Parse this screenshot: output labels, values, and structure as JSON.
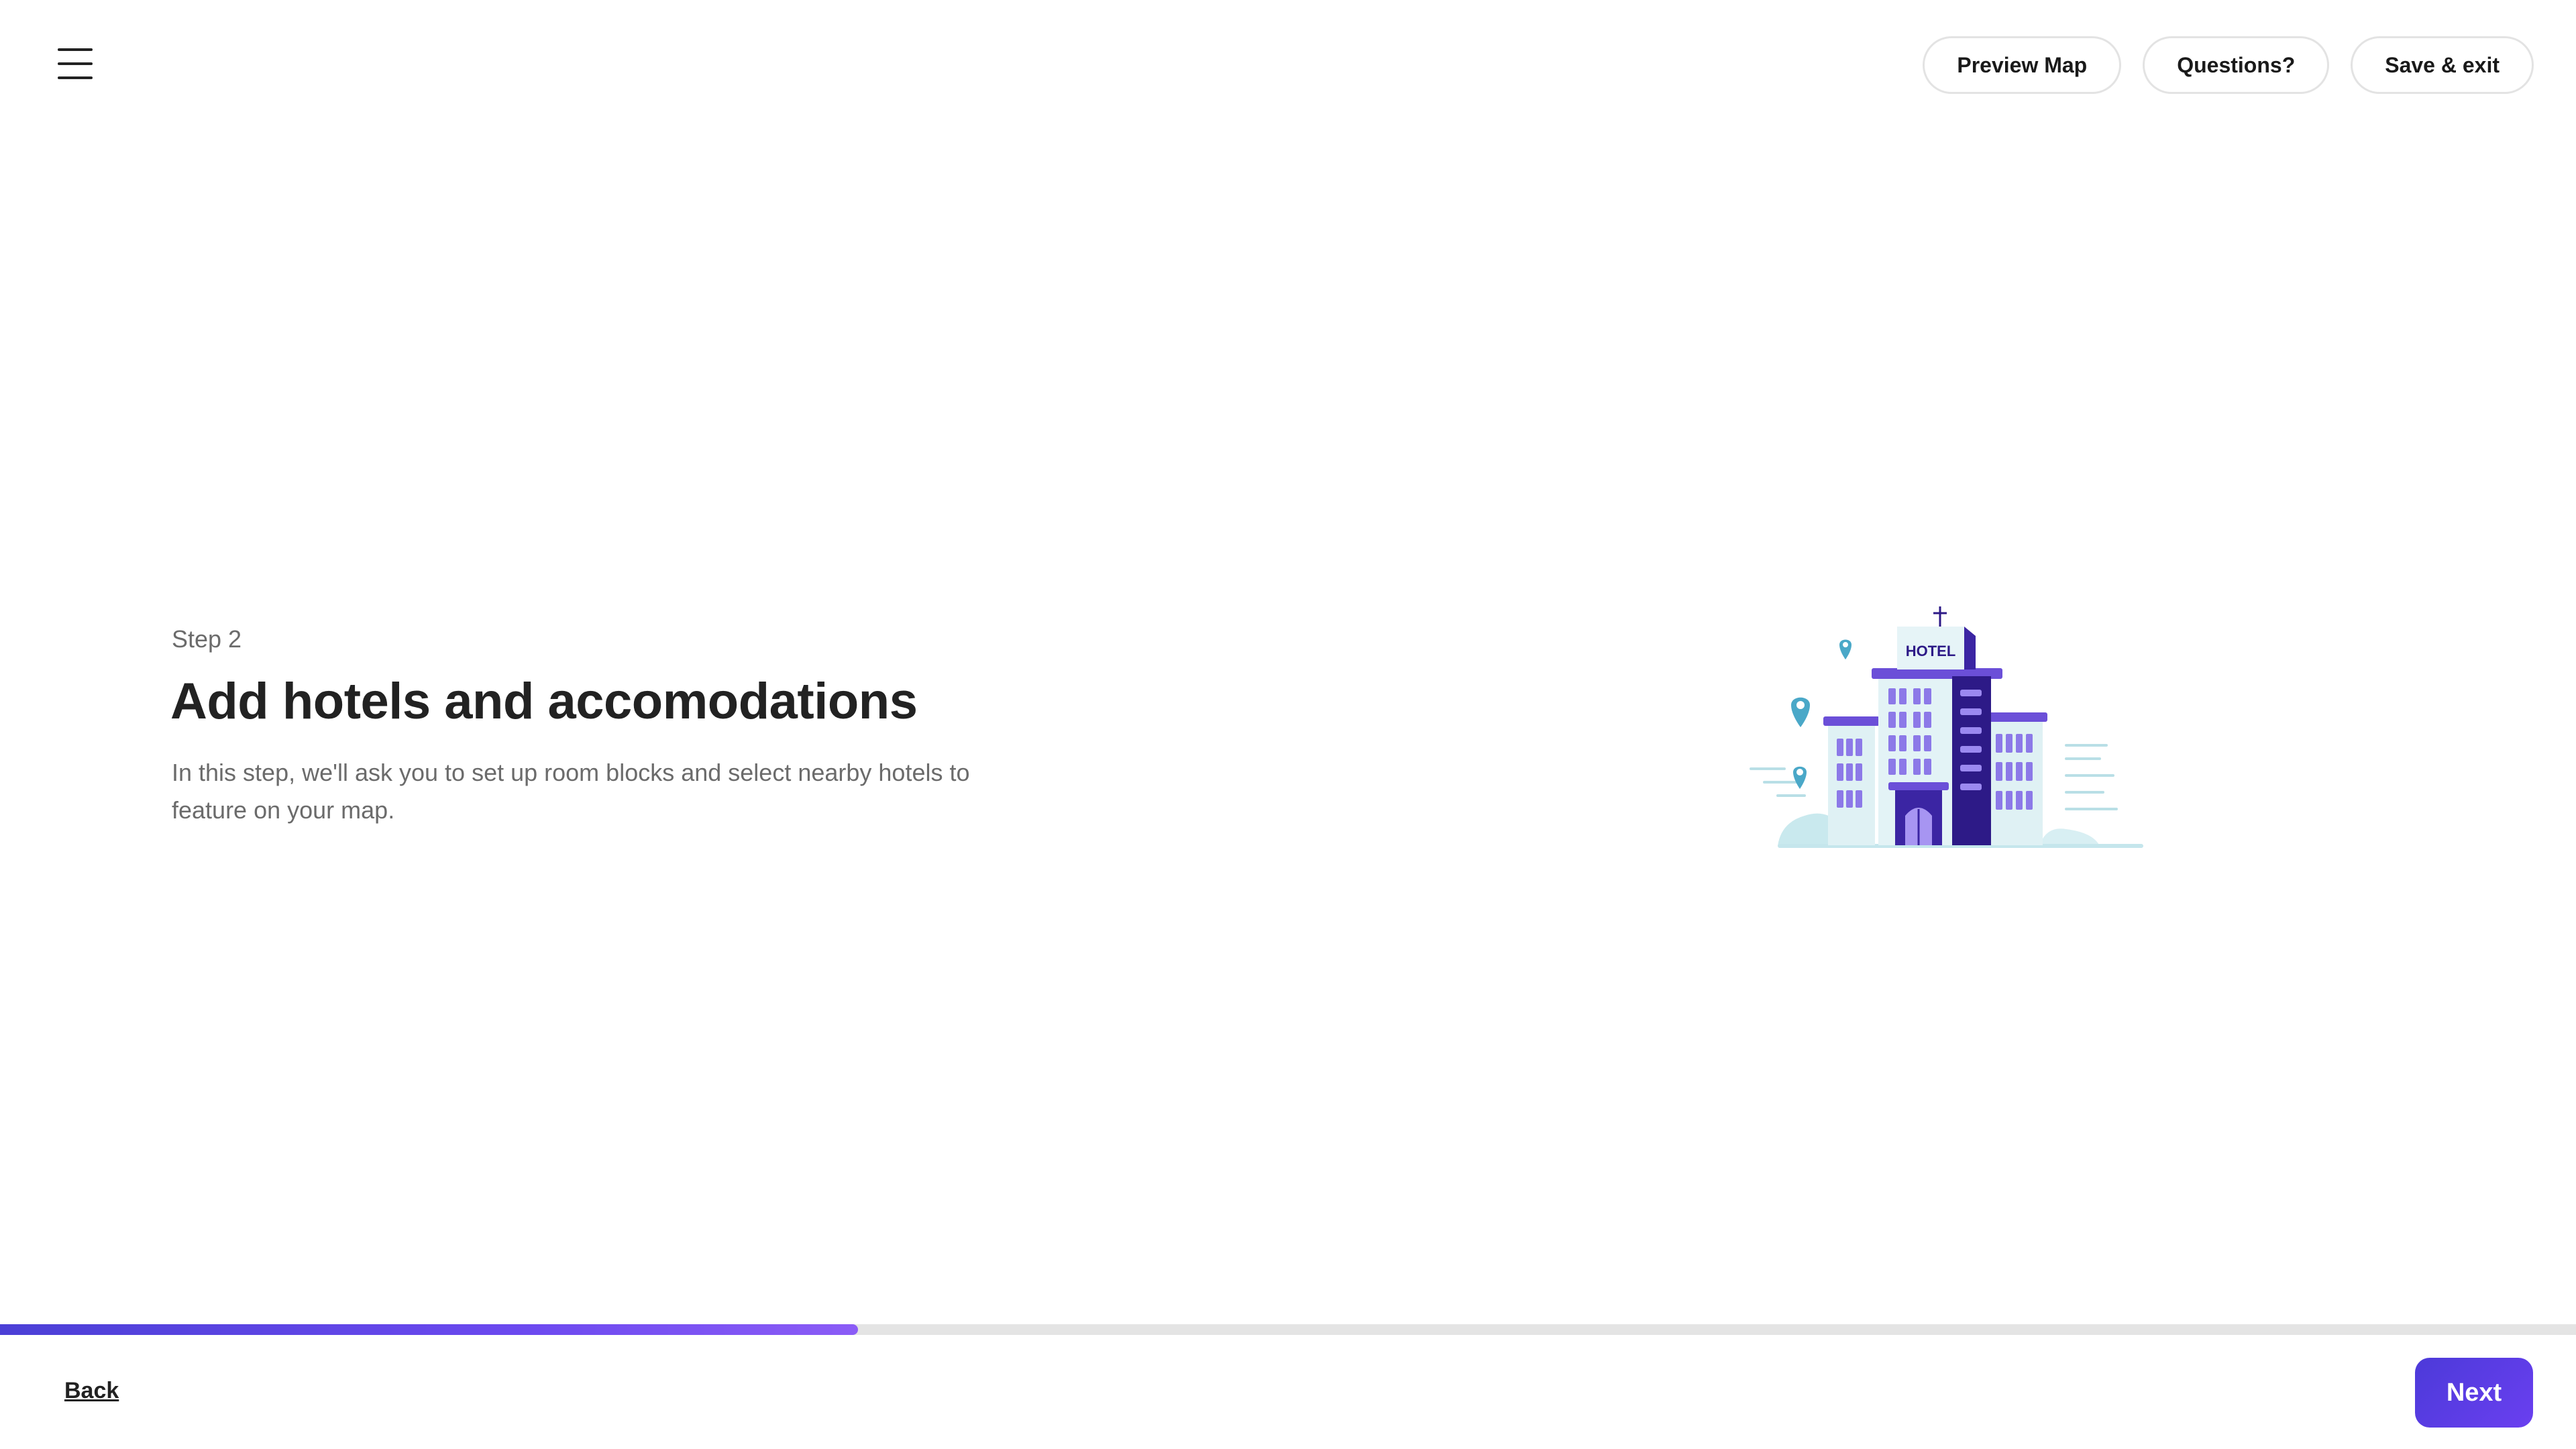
{
  "header": {
    "menu_icon": "hamburger-menu-icon",
    "actions": {
      "preview_map": "Preview Map",
      "questions": "Questions?",
      "save_exit": "Save & exit"
    }
  },
  "main": {
    "step_label": "Step 2",
    "title": "Add hotels and accomodations",
    "description": "In this step, we'll ask you to set up room blocks and select nearby hotels to feature on your map.",
    "illustration": {
      "icon": "hotel-illustration",
      "sign_text": "HOTEL"
    }
  },
  "progress": {
    "fraction": 0.333
  },
  "footer": {
    "back_label": "Back",
    "next_label": "Next"
  },
  "colors": {
    "accent": "#5b3ee6",
    "accent_light": "#8b5cf6",
    "building_dark": "#2d1a87",
    "building_mid": "#6b4fd8",
    "building_light": "#d6eef2",
    "pin": "#4aa8c8"
  }
}
